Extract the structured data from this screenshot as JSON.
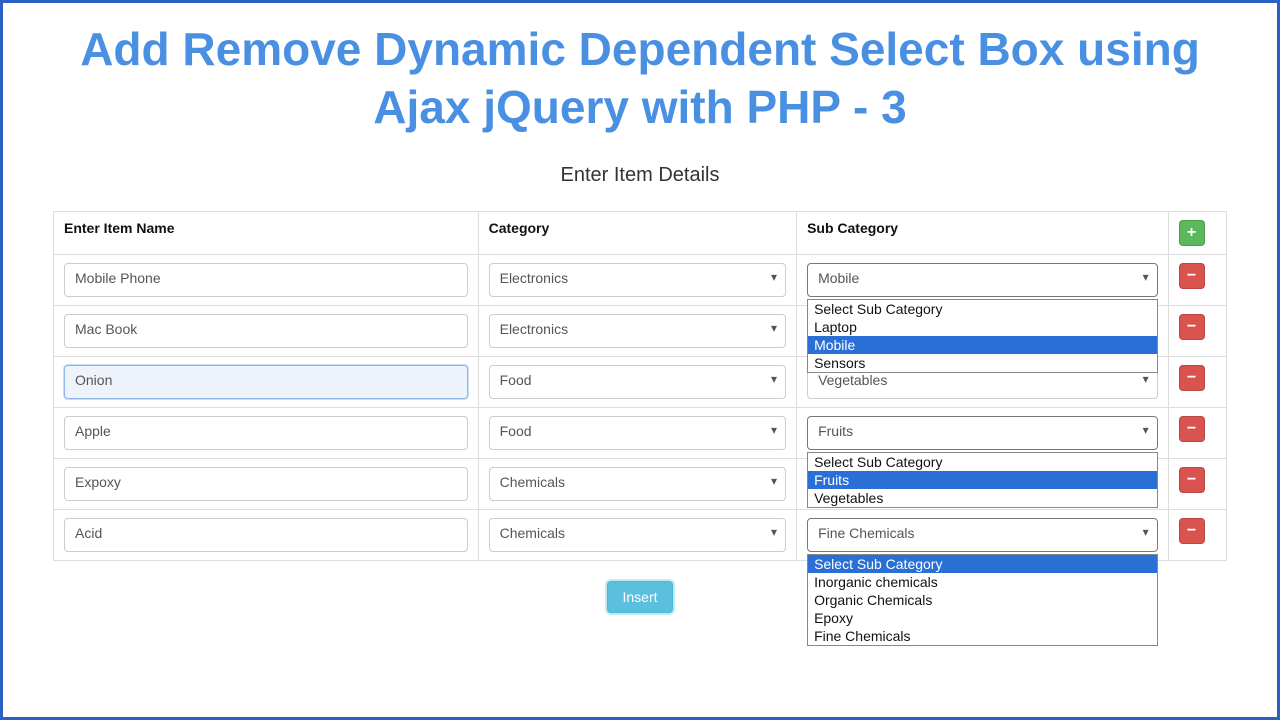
{
  "title": "Add Remove Dynamic Dependent Select Box using Ajax jQuery with PHP - 3",
  "subtitle": "Enter Item Details",
  "headers": {
    "name": "Enter Item Name",
    "category": "Category",
    "subcategory": "Sub Category"
  },
  "rows": [
    {
      "name": "Mobile Phone",
      "category": "Electronics",
      "sub": "Mobile",
      "dropdown": {
        "options": [
          "Select Sub Category",
          "Laptop",
          "Mobile",
          "Sensors"
        ],
        "highlight": "Mobile"
      }
    },
    {
      "name": "Mac Book",
      "category": "Electronics",
      "sub": ""
    },
    {
      "name": "Onion",
      "category": "Food",
      "sub": "Vegetables",
      "name_focus": true
    },
    {
      "name": "Apple",
      "category": "Food",
      "sub": "Fruits",
      "dropdown": {
        "options": [
          "Select Sub Category",
          "Fruits",
          "Vegetables"
        ],
        "highlight": "Fruits"
      }
    },
    {
      "name": "Expoxy",
      "category": "Chemicals",
      "sub": ""
    },
    {
      "name": "Acid",
      "category": "Chemicals",
      "sub": "Fine Chemicals",
      "dropdown": {
        "options": [
          "Select Sub Category",
          "Inorganic chemicals",
          "Organic Chemicals",
          "Epoxy",
          "Fine Chemicals"
        ],
        "highlight": "Select Sub Category"
      }
    }
  ],
  "buttons": {
    "add": "+",
    "remove": "−",
    "insert": "Insert"
  }
}
